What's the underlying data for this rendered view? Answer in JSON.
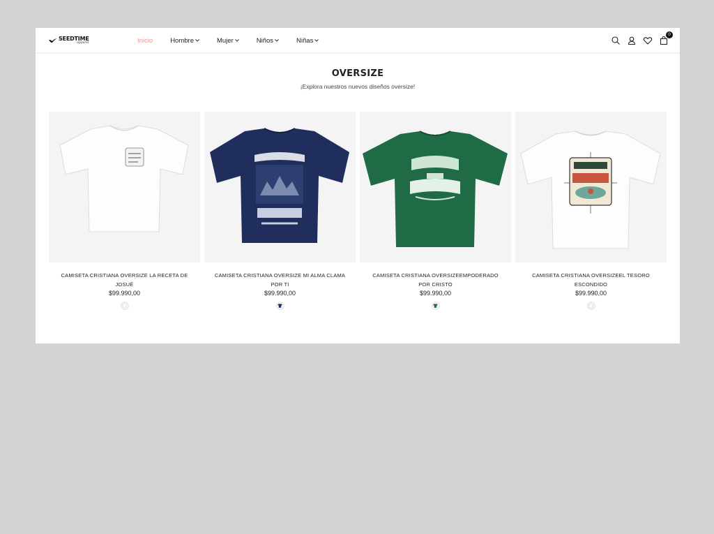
{
  "brand": {
    "name": "SEEDTIME",
    "sub": "apparel"
  },
  "nav": [
    {
      "label": "Inicio",
      "active": true,
      "dropdown": false
    },
    {
      "label": "Hombre",
      "active": false,
      "dropdown": true
    },
    {
      "label": "Mujer",
      "active": false,
      "dropdown": true
    },
    {
      "label": "Niños",
      "active": false,
      "dropdown": true
    },
    {
      "label": "Niñas",
      "active": false,
      "dropdown": true
    }
  ],
  "header_icons": [
    "search-icon",
    "user-icon",
    "heart-icon",
    "shopping-bag-icon"
  ],
  "cart": {
    "count": "0"
  },
  "section": {
    "title": "OVERSIZE",
    "subtitle": "¡Explora nuestros nuevos diseños oversize!"
  },
  "colors": {
    "accent": "#e89a9a",
    "navy": "#1f2e5c",
    "green": "#1f6b45",
    "white_tee": "#ffffff"
  },
  "products": [
    {
      "name": "CAMISETA CRISTIANA OVERSIZE LA RECETA DE JOSUÉ",
      "price": "$99.990,00",
      "shirt_color": "white",
      "swatch_color": "#ffffff"
    },
    {
      "name": "CAMISETA CRISTIANA OVERSIZE MI ALMA CLAMA POR TI",
      "price": "$99.990,00",
      "shirt_color": "navy",
      "swatch_color": "#1f2e5c"
    },
    {
      "name": "CAMISETA CRISTIANA OVERSIZEEMPODERADO POR CRISTO",
      "price": "$99.990,00",
      "shirt_color": "green",
      "swatch_color": "#1f6b45"
    },
    {
      "name": "CAMISETA CRISTIANA OVERSIZEEL TESORO ESCONDIDO",
      "price": "$99.990,00",
      "shirt_color": "white",
      "swatch_color": "#ffffff"
    }
  ]
}
